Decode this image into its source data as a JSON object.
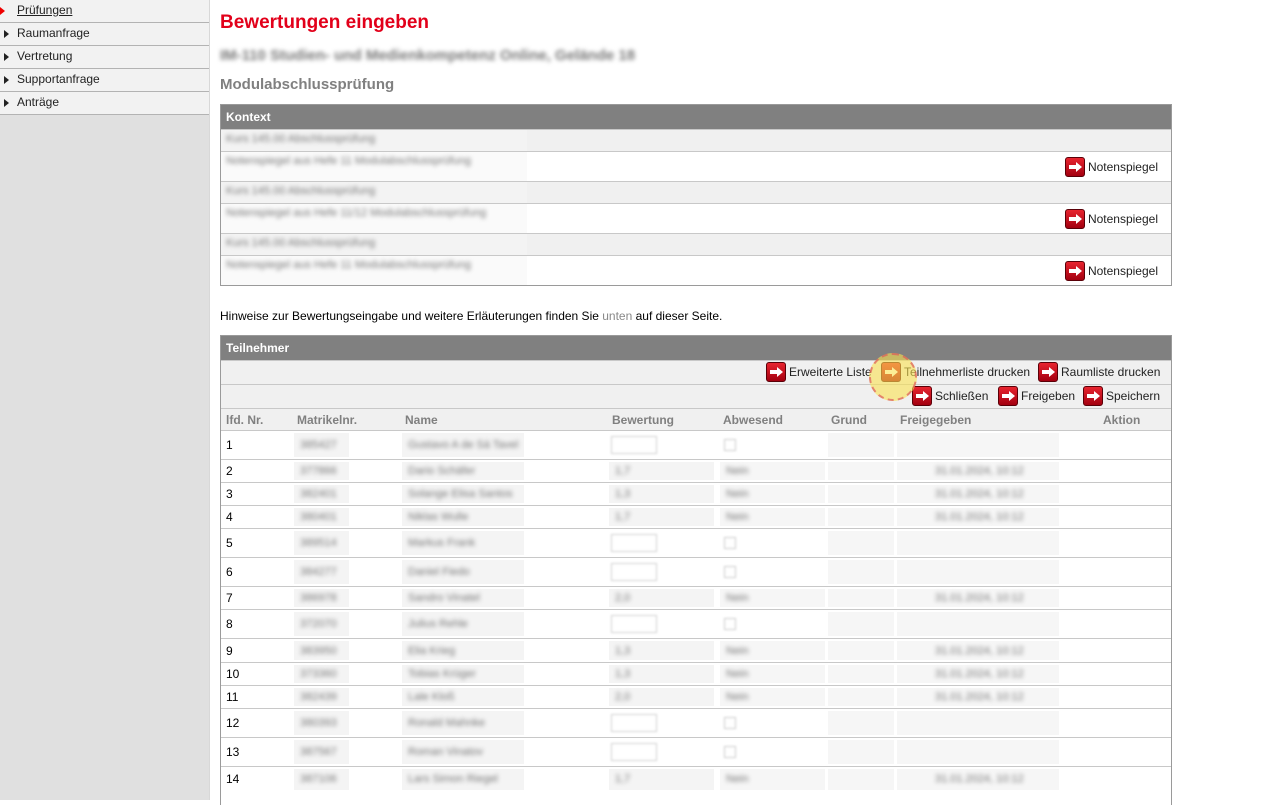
{
  "sidebar": {
    "items": [
      {
        "label": "Prüfungen",
        "active": true
      },
      {
        "label": "Raumanfrage"
      },
      {
        "label": "Vertretung"
      },
      {
        "label": "Supportanfrage"
      },
      {
        "label": "Anträge"
      }
    ]
  },
  "page": {
    "title": "Bewertungen eingeben",
    "subtitle": "IM-110 Studien- und Medienkompetenz Online, Gelände 18",
    "heading": "Modulabschlussprüfung"
  },
  "context": {
    "header": "Kontext",
    "rows": [
      {
        "line1": "Kurs 145.00 Abschlussprüfung",
        "line2": "Notenspiegel aus Hefe 11 Modulabschlussprüfung",
        "button": "Notenspiegel"
      },
      {
        "line1": "Kurs 145.00 Abschlussprüfung",
        "line2": "Notenspiegel aus Hefe 11/12 Modulabschlussprüfung",
        "button": "Notenspiegel"
      },
      {
        "line1": "Kurs 145.00 Abschlussprüfung",
        "line2": "Notenspiegel aus Hefe 11 Modulabschlussprüfung",
        "button": "Notenspiegel"
      }
    ]
  },
  "hint": {
    "before": "Hinweise zur Bewertungseingabe und weitere Erläuterungen finden Sie ",
    "link": "unten",
    "after": " auf dieser Seite."
  },
  "participants": {
    "header": "Teilnehmer",
    "toolbar1": {
      "extended": "Erweiterte Liste",
      "print_participants": "Teilnehmerliste drucken",
      "print_room": "Raumliste drucken"
    },
    "toolbar2": {
      "close": "Schließen",
      "release": "Freigeben",
      "save": "Speichern"
    },
    "columns": [
      "lfd. Nr.",
      "Matrikelnr.",
      "Name",
      "Bewertung",
      "Abwesend",
      "Grund",
      "Freigegeben",
      "Aktion"
    ],
    "rows": [
      {
        "nr": "1",
        "matrikel": "385427",
        "name": "Gustavo A de Sá Tavel",
        "grade": "",
        "abwesend": "",
        "frei": "",
        "editable": true
      },
      {
        "nr": "2",
        "matrikel": "377866",
        "name": "Dario Schäfer",
        "grade": "1,7",
        "abwesend": "Nein",
        "frei": "31.01.2024, 10:12",
        "editable": false
      },
      {
        "nr": "3",
        "matrikel": "382401",
        "name": "Solange Elisa Santos",
        "grade": "1,3",
        "abwesend": "Nein",
        "frei": "31.01.2024, 10:12",
        "editable": false
      },
      {
        "nr": "4",
        "matrikel": "380401",
        "name": "Niklas Wulle",
        "grade": "1,7",
        "abwesend": "Nein",
        "frei": "31.01.2024, 10:12",
        "editable": false
      },
      {
        "nr": "5",
        "matrikel": "389514",
        "name": "Markus Frank",
        "grade": "",
        "abwesend": "",
        "frei": "",
        "editable": true
      },
      {
        "nr": "6",
        "matrikel": "384277",
        "name": "Daniel Fiedo",
        "grade": "",
        "abwesend": "",
        "frei": "",
        "editable": true
      },
      {
        "nr": "7",
        "matrikel": "386978",
        "name": "Sandro Vinatel",
        "grade": "2,0",
        "abwesend": "Nein",
        "frei": "31.01.2024, 10:12",
        "editable": false
      },
      {
        "nr": "8",
        "matrikel": "372070",
        "name": "Julius Rehle",
        "grade": "",
        "abwesend": "",
        "frei": "",
        "editable": true
      },
      {
        "nr": "9",
        "matrikel": "383950",
        "name": "Elia Krieg",
        "grade": "1,3",
        "abwesend": "Nein",
        "frei": "31.01.2024, 10:12",
        "editable": false
      },
      {
        "nr": "10",
        "matrikel": "373360",
        "name": "Tobias Krüger",
        "grade": "1,3",
        "abwesend": "Nein",
        "frei": "31.01.2024, 10:12",
        "editable": false
      },
      {
        "nr": "11",
        "matrikel": "382439",
        "name": "Lale Kloß",
        "grade": "2,0",
        "abwesend": "Nein",
        "frei": "31.01.2024, 10:12",
        "editable": false
      },
      {
        "nr": "12",
        "matrikel": "380393",
        "name": "Ronald Mahnke",
        "grade": "",
        "abwesend": "",
        "frei": "",
        "editable": true
      },
      {
        "nr": "13",
        "matrikel": "387567",
        "name": "Roman Vinatov",
        "grade": "",
        "abwesend": "",
        "frei": "",
        "editable": true
      },
      {
        "nr": "14",
        "matrikel": "387106",
        "name": "Lars Simon Riegel",
        "grade": "1,7",
        "abwesend": "Nein",
        "frei": "31.01.2024, 10:12",
        "editable": false
      }
    ]
  },
  "colors": {
    "accent": "#e2001a",
    "header_bg": "#808080",
    "row_alt": "#f0f0f0"
  },
  "icons": {
    "action": "red-arrow-icon",
    "cursor": "mouse-pointer-icon"
  }
}
